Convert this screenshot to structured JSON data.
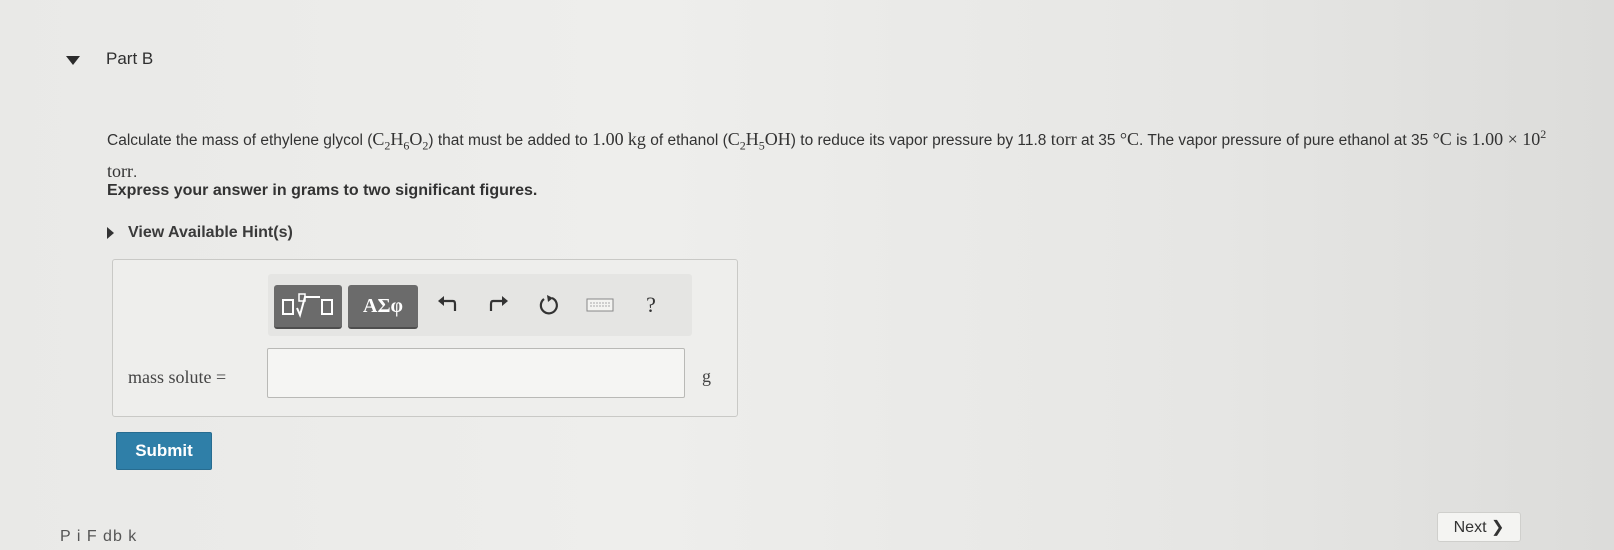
{
  "part": {
    "title": "Part B"
  },
  "question": {
    "t1": "Calculate the mass of ethylene glycol (",
    "glycol_formula": "C2H6O2",
    "t2": ") that must be added to",
    "mass_value": "1.00",
    "mass_unit": "kg",
    "t3": "of ethanol (",
    "ethanol_formula": "C2H5OH",
    "t4": ") to reduce its vapor pressure by 11.8",
    "torr1": "torr",
    "t5": "at 35",
    "deg1": "°C",
    "t6": ". The vapor pressure of pure ethanol at 35",
    "deg2": "°C",
    "t7": "is",
    "vp_value": "1.00 × 10",
    "vp_exp": "2",
    "torr2": "torr",
    "t8": "."
  },
  "instruction": "Express your answer in grams to two significant figures.",
  "hint_label": "View Available Hint(s)",
  "toolbar": {
    "greek_label": "ΑΣφ",
    "help_label": "?"
  },
  "answer": {
    "label": "mass solute =",
    "value": "",
    "unit": "g"
  },
  "submit_label": "Submit",
  "next_label": "Next ❯",
  "cut_text": "P    i   F    db    k"
}
